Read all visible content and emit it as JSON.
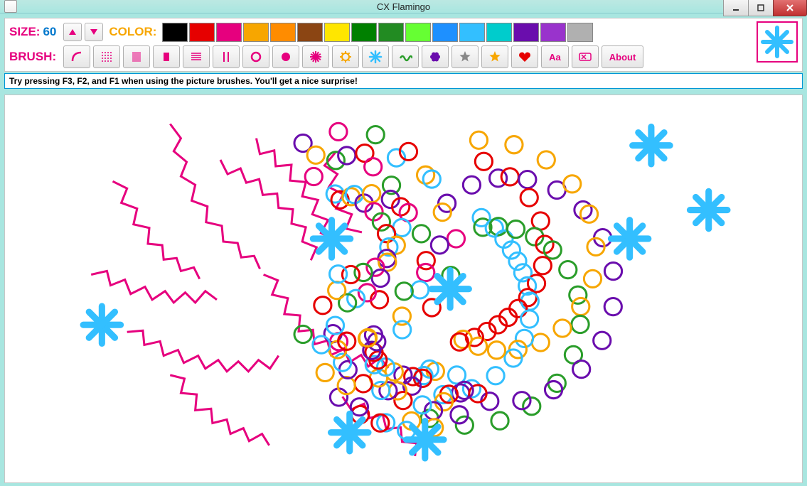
{
  "window": {
    "title": "CX Flamingo"
  },
  "toolbar": {
    "size_label": "SIZE:",
    "size_value": "60",
    "color_label": "COLOR:",
    "brush_label": "BRUSH:",
    "about_label": "About",
    "text_tool_label": "Aa"
  },
  "colors": {
    "swatches": [
      "#000000",
      "#e60000",
      "#e6007e",
      "#f7a600",
      "#ff8c00",
      "#8b4513",
      "#ffe600",
      "#008000",
      "#228b22",
      "#66ff33",
      "#1e90ff",
      "#33bfff",
      "#00cccc",
      "#6a0dad",
      "#9933cc",
      "#b0b0b0"
    ],
    "accent_pink": "#e6007e",
    "accent_blue": "#33bfff",
    "accent_orange": "#f7a600"
  },
  "brush_icons": [
    "curve-icon",
    "dots-icon",
    "vbar-dense-icon",
    "rect-icon",
    "hlines-icon",
    "vlines-icon",
    "ring-icon",
    "disc-icon",
    "burst-icon",
    "gear-icon",
    "snowflake-icon",
    "squiggle-icon",
    "flower-icon",
    "star-grey-icon",
    "star-gold-icon",
    "heart-icon"
  ],
  "hint": "Try pressing F3, F2, and F1 when using the picture brushes. You'll get a nice surprise!",
  "current_brush_icon": "snowflake-icon",
  "current_brush_color": "#33bfff"
}
